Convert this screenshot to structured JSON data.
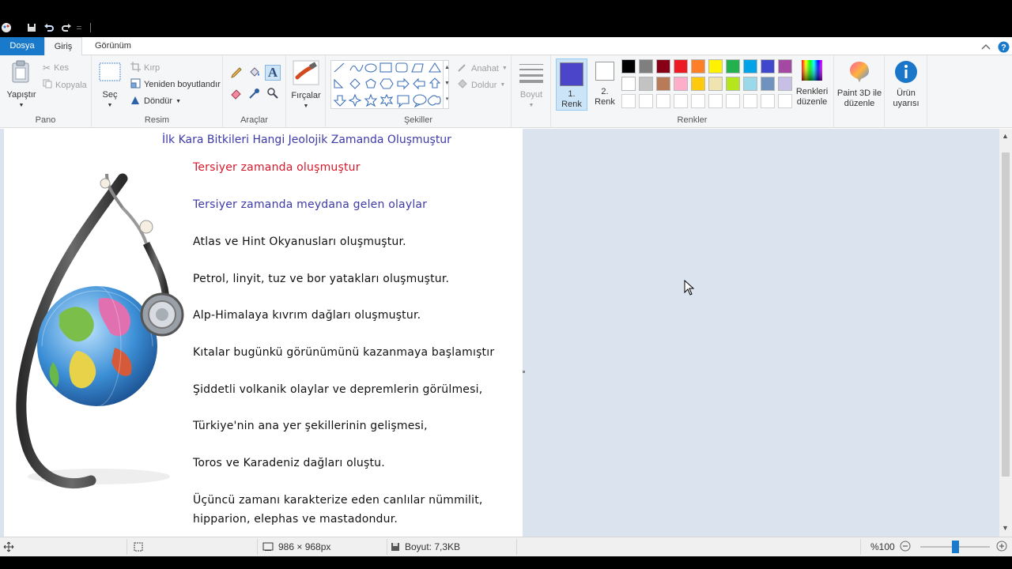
{
  "tabs": {
    "file": "Dosya",
    "home": "Giriş",
    "view": "Görünüm"
  },
  "ribbon": {
    "clipboard": {
      "paste": "Yapıştır",
      "cut": "Kes",
      "copy": "Kopyala",
      "label": "Pano"
    },
    "image": {
      "select": "Seç",
      "crop": "Kırp",
      "resize": "Yeniden boyutlandır",
      "rotate": "Döndür",
      "label": "Resim"
    },
    "tools": {
      "label": "Araçlar"
    },
    "brushes": {
      "label": "Fırçalar"
    },
    "shapes": {
      "outline": "Anahat",
      "fill": "Doldur",
      "label": "Şekiller"
    },
    "size": {
      "label": "Boyut"
    },
    "colors": {
      "color1_line1": "1.",
      "color1_line2": "Renk",
      "color2_line1": "2.",
      "color2_line2": "Renk",
      "edit_line1": "Renkleri",
      "edit_line2": "düzenle",
      "label": "Renkler",
      "color1": "#4a45c9",
      "color2": "#ffffff",
      "palette_row1": [
        "#000000",
        "#7f7f7f",
        "#880015",
        "#ed1c24",
        "#ff7f27",
        "#fff200",
        "#22b14c",
        "#00a2e8",
        "#3f48cc",
        "#a349a4"
      ],
      "palette_row2": [
        "#ffffff",
        "#c3c3c3",
        "#b97a57",
        "#ffaec9",
        "#ffc90e",
        "#efe4b0",
        "#b5e61d",
        "#99d9ea",
        "#7092be",
        "#c8bfe7"
      ]
    },
    "paint3d": {
      "line1": "Paint 3D ile",
      "line2": "düzenle"
    },
    "alert": {
      "line1": "Ürün",
      "line2": "uyarısı"
    }
  },
  "document": {
    "title": "İlk Kara Bitkileri Hangi Jeolojik Zamanda Oluşmuştur",
    "line1": "Tersiyer zamanda oluşmuştur",
    "line2": "Tersiyer zamanda meydana gelen olaylar",
    "line3": "Atlas ve Hint Okyanusları oluşmuştur.",
    "line4": "Petrol, linyit,  tuz ve bor yatakları oluşmuştur.",
    "line5": "Alp-Himalaya  kıvrım dağları oluşmuştur.",
    "line6": "Kıtalar bugünkü görünümünü kazanmaya başlamıştır",
    "line7": "Şiddetli volkanik olaylar ve depremlerin görülmesi,",
    "line8": "Türkiye'nin ana yer şekillerinin gelişmesi,",
    "line9": "Toros ve Karadeniz dağları oluştu.",
    "line10": "Üçüncü zamanı karakterize eden canlılar nümmilit,",
    "line11": "hipparion, elephas ve mastadondur."
  },
  "status": {
    "dimensions": "986 × 968px",
    "size": "Boyut: 7,3KB",
    "zoom": "%100",
    "zoom_level_percent": 100
  }
}
